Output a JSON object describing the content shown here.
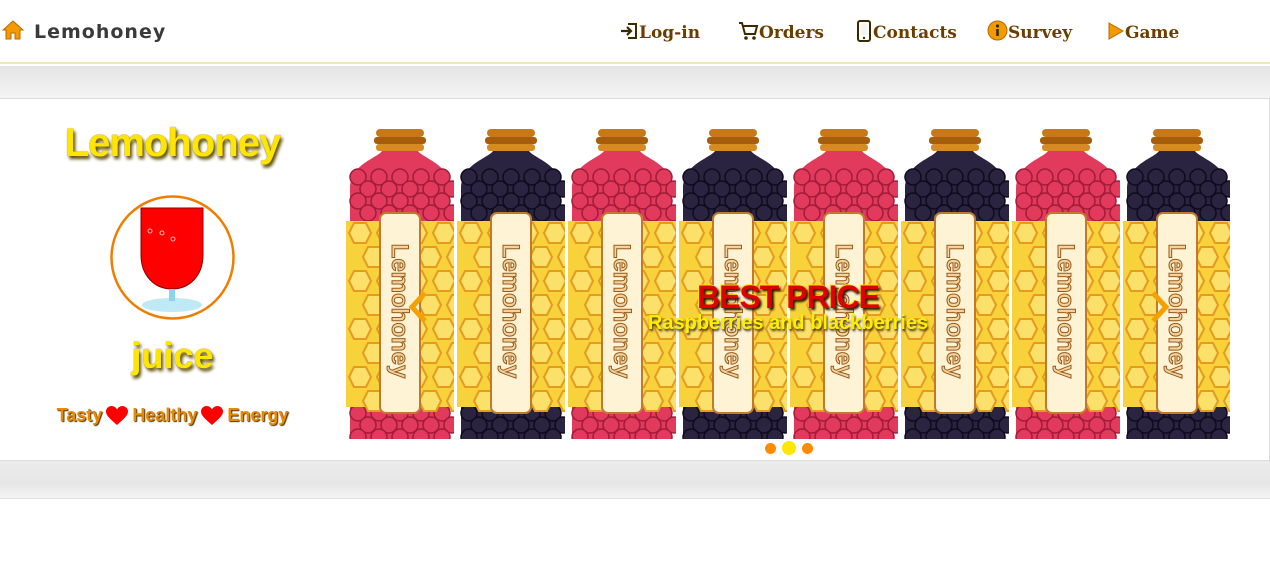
{
  "navbar": {
    "brand": "Lemohoney",
    "items": [
      {
        "label": "Log-in",
        "icon": "login-icon"
      },
      {
        "label": "Orders",
        "icon": "cart-icon"
      },
      {
        "label": "Contacts",
        "icon": "mobile-phone-icon"
      },
      {
        "label": "Survey",
        "icon": "info-circle-icon"
      },
      {
        "label": "Game",
        "icon": "play-icon"
      }
    ]
  },
  "promo": {
    "title": "Lemohoney",
    "product": "juice",
    "tagline": [
      "Tasty",
      "Healthy",
      "Energy"
    ]
  },
  "carousel": {
    "bottle_label": "Lemohoney",
    "caption_title": "BEST PRICE",
    "caption_subtitle": "Raspberries and blackberries",
    "slide_count": 3,
    "active_slide": 2,
    "bottles": [
      "raspberry",
      "blackberry",
      "raspberry",
      "blackberry",
      "raspberry",
      "blackberry",
      "raspberry",
      "blackberry"
    ]
  },
  "colors": {
    "accent_orange": "#ff8c00",
    "accent_yellow": "#ffe600",
    "caption_red": "#dd0000",
    "raspberry": "#e23a5c",
    "blackberry": "#2a2440",
    "honeycomb": "#f7d23a"
  }
}
